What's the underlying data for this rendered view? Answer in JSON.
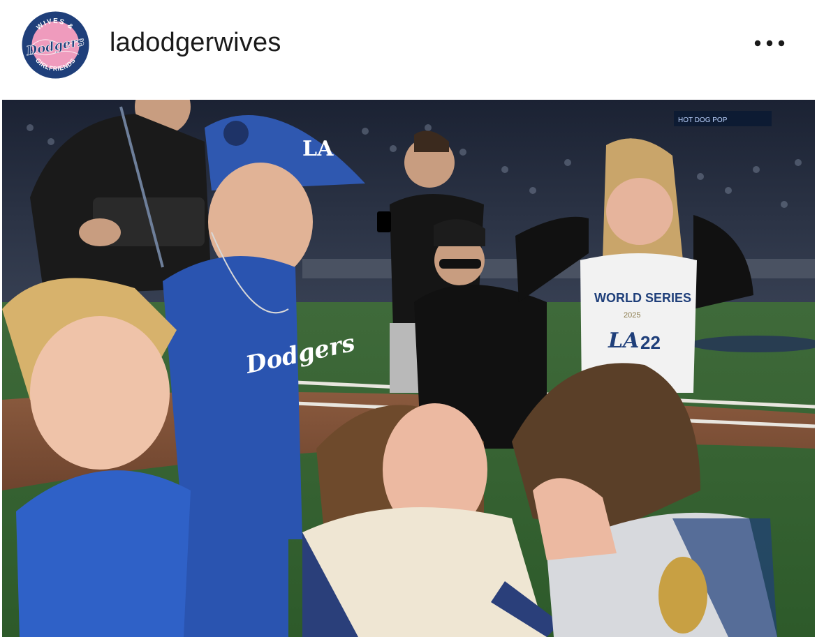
{
  "post": {
    "username": "ladodgerwives",
    "more_icon": "more-horizontal-icon"
  },
  "avatar": {
    "arc_top": "WIVES &",
    "script": "Dodgers",
    "arc_bottom": "GIRLFRIENDS",
    "ring_color": "#1f3f7a",
    "fill_color": "#ef9bbd",
    "accent": "#ffffff"
  },
  "photo": {
    "description_hidden": true,
    "cap_logo": "LA",
    "shirt_logo": "Dodgers",
    "jersey_title": "WORLD SERIES",
    "jersey_year": "2025",
    "jersey_team": "LA",
    "jersey_number": "22",
    "scoreboard_text": "HOT DOG POP"
  }
}
